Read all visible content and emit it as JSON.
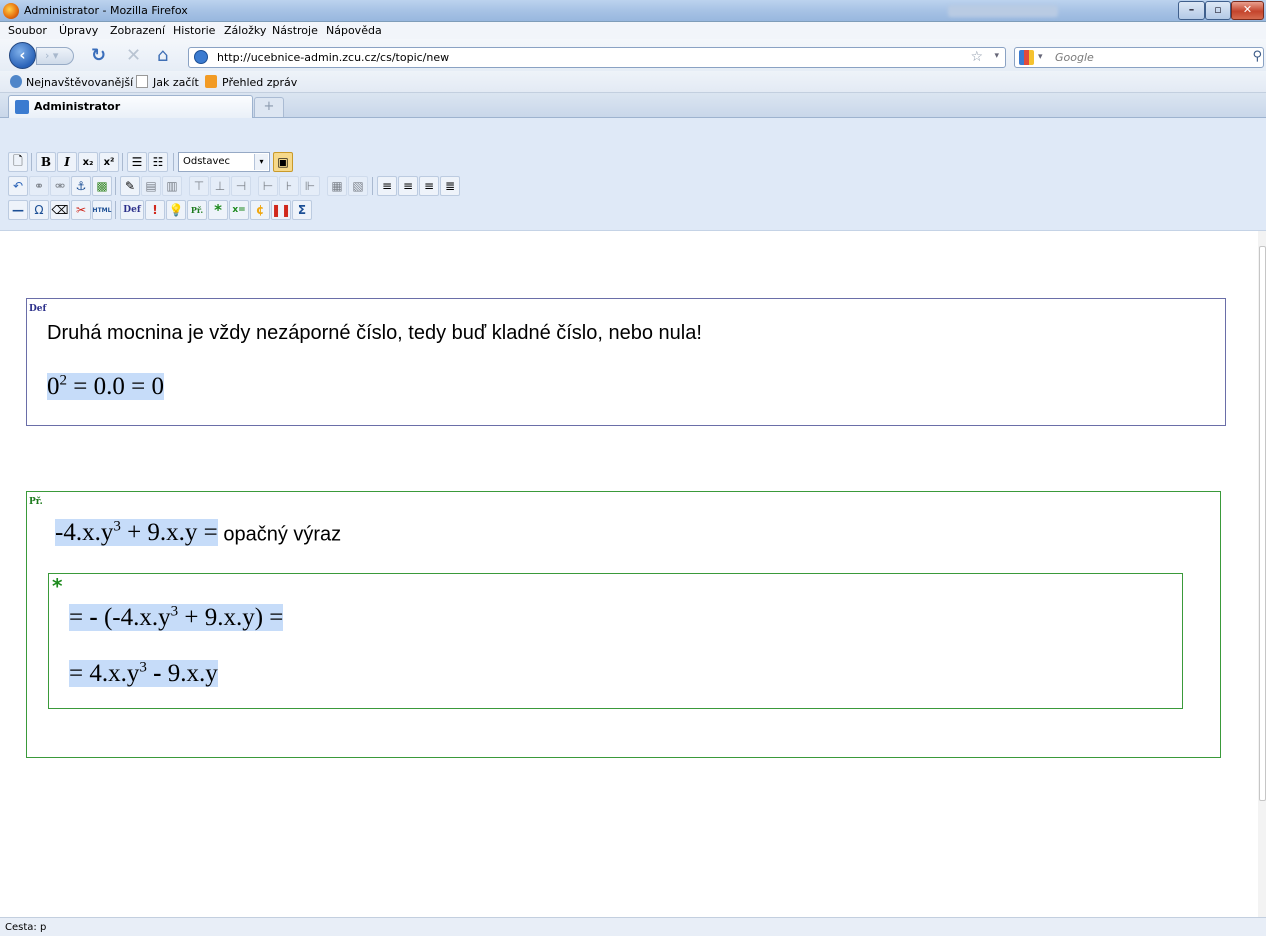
{
  "window": {
    "title": "Administrator - Mozilla Firefox"
  },
  "menu": [
    "Soubor",
    "Úpravy",
    "Zobrazení",
    "Historie",
    "Záložky",
    "Nástroje",
    "Nápověda"
  ],
  "nav": {
    "url": "http://ucebnice-admin.zcu.cz/cs/topic/new",
    "search_placeholder": "Google"
  },
  "bookmarks": [
    "Nejnavštěvovanější",
    "Jak začít",
    "Přehled zpráv"
  ],
  "tab": {
    "label": "Administrator",
    "newtab": "+"
  },
  "toolbar": {
    "format_value": "Odstavec",
    "def_label": "Def",
    "pr_label": "Př.",
    "html_label": "HTML",
    "x_eq_label": "x=",
    "icons_row1": [
      "new-document-icon",
      "bold-icon",
      "italic-icon",
      "subscript-icon",
      "superscript-icon",
      "bullet-list-icon",
      "numbered-list-icon",
      "format-select",
      "fullscreen-icon"
    ],
    "icons_row2": [
      "undo-icon",
      "link-icon",
      "unlink-icon",
      "anchor-icon",
      "image-icon",
      "edit-icon",
      "table-icon",
      "row-icon",
      "cell-icon",
      "align-left-icon",
      "align-center-icon",
      "align-right-icon",
      "justify-icon"
    ],
    "icons_row3": [
      "horizontal-rule-icon",
      "omega-icon",
      "eraser-icon",
      "tool-icon",
      "html-icon",
      "def-icon",
      "exclamation-icon",
      "bulb-icon",
      "example-icon",
      "star-icon",
      "x-equals-icon",
      "hint-icon",
      "pause-icon",
      "sigma-icon"
    ]
  },
  "content": {
    "def_tag": "Def",
    "def_text": "Druhá mocnina je vždy nezáporné číslo, tedy buď kladné číslo, nebo nula!",
    "def_math_base": "0",
    "def_math_exp": "2",
    "def_math_rest": " = 0.0 = 0",
    "ex_tag": "Př.",
    "ex_math_a": "-4.x.y",
    "ex_math_exp": "3",
    "ex_math_b": " + 9.x.y =",
    "ex_text": " opačný výraz",
    "sol_star": "*",
    "sol1_a": "= ",
    "sol1_minus": "-",
    "sol1_b": " (-4.x.y",
    "sol1_exp": "3",
    "sol1_c": " + 9.x.y) =",
    "sol2_a": "= 4.x.y",
    "sol2_exp": "3",
    "sol2_minus": " -",
    "sol2_b": " 9.x.y"
  },
  "status": {
    "path": "Cesta: p"
  },
  "colors": {
    "math_highlight": "#c6dcf9",
    "def_border": "#6a6ea8",
    "example_border": "#3a9a3a",
    "toolbar_bg": "#dfe9f7"
  }
}
